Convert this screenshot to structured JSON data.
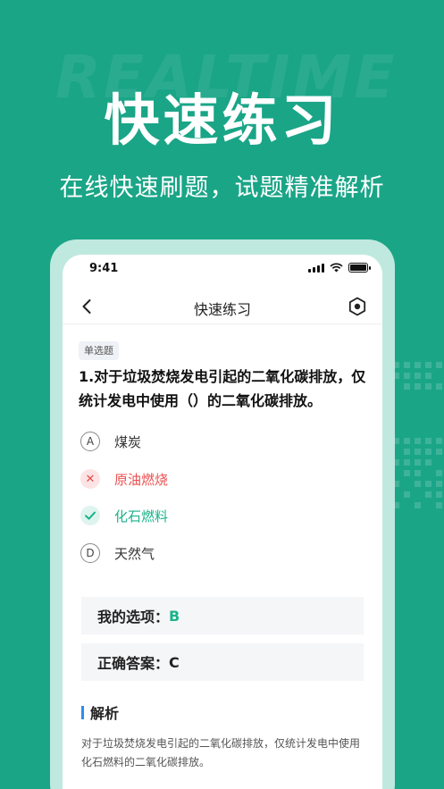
{
  "watermark": "REALTIME",
  "hero": {
    "title": "快速练习",
    "subtitle": "在线快速刷题，试题精准解析"
  },
  "status_bar": {
    "time": "9:41"
  },
  "nav": {
    "title": "快速练习",
    "back_icon": "chevron-left-icon",
    "settings_icon": "hexagon-settings-icon"
  },
  "question": {
    "type": "单选题",
    "text": "1.对于垃圾焚烧发电引起的二氧化碳排放，仅统计发电中使用（）的二氧化碳排放。",
    "options": [
      {
        "key": "A",
        "label": "煤炭",
        "state": "normal"
      },
      {
        "key": "B",
        "label": "原油燃烧",
        "state": "wrong"
      },
      {
        "key": "C",
        "label": "化石燃料",
        "state": "right"
      },
      {
        "key": "D",
        "label": "天然气",
        "state": "normal"
      }
    ]
  },
  "answers": {
    "my_label": "我的选项：",
    "my_value": "B",
    "correct_label": "正确答案：",
    "correct_value": "C"
  },
  "analysis": {
    "title": "解析",
    "text": "对于垃圾焚烧发电引起的二氧化碳排放，仅统计发电中使用化石燃料的二氧化碳排放。"
  },
  "colors": {
    "background": "#1aa587",
    "correct": "#1ab38a",
    "wrong": "#ec5050",
    "accent_bar": "#2e8cf0"
  }
}
